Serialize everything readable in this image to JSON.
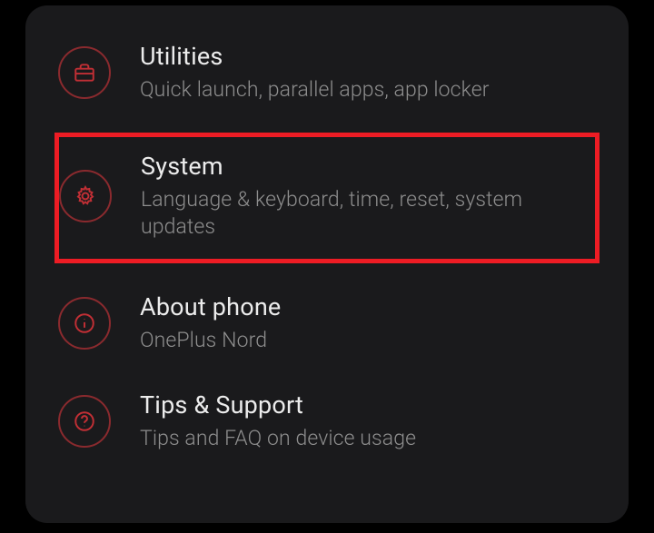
{
  "settings": {
    "items": [
      {
        "icon": "toolbox-icon",
        "title": "Utilities",
        "subtitle": "Quick launch, parallel apps, app locker"
      },
      {
        "icon": "gear-icon",
        "title": "System",
        "subtitle": "Language & keyboard, time, reset, system updates"
      },
      {
        "icon": "info-icon",
        "title": "About phone",
        "subtitle": "OnePlus Nord"
      },
      {
        "icon": "help-icon",
        "title": "Tips & Support",
        "subtitle": "Tips and FAQ on device usage"
      }
    ]
  },
  "highlight_index": 1
}
